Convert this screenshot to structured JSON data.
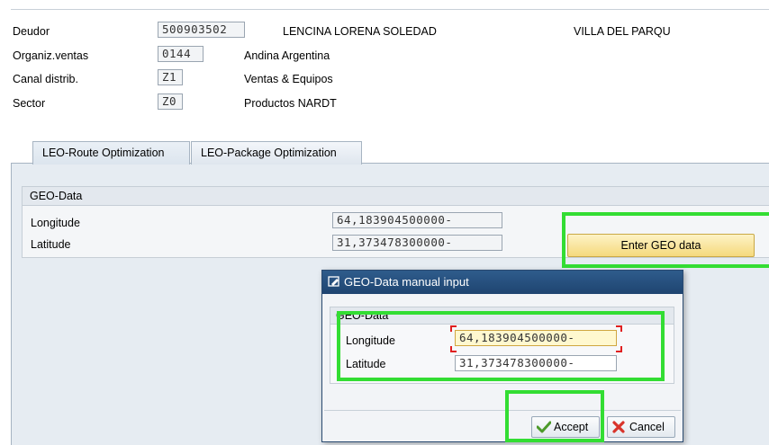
{
  "header": {
    "deudor_label": "Deudor",
    "deudor_value": "500903502",
    "deudor_name": "LENCINA LORENA SOLEDAD",
    "deudor_city": "VILLA DEL PARQU",
    "org_label": "Organiz.ventas",
    "org_value": "0144",
    "org_name": "Andina Argentina",
    "canal_label": "Canal distrib.",
    "canal_value": "Z1",
    "canal_name": "Ventas & Equipos",
    "sector_label": "Sector",
    "sector_value": "Z0",
    "sector_name": "Productos NARDT"
  },
  "tabs": [
    {
      "label": "LEO-Route Optimization",
      "active": true
    },
    {
      "label": "LEO-Package Optimization",
      "active": false
    }
  ],
  "geo": {
    "group_title": "GEO-Data",
    "longitude_label": "Longitude",
    "longitude_value": "64,183904500000-",
    "latitude_label": "Latitude",
    "latitude_value": "31,373478300000-",
    "enter_button": "Enter GEO data"
  },
  "dialog": {
    "title": "GEO-Data manual input",
    "group_title": "GEO-Data",
    "longitude_label": "Longitude",
    "longitude_value": "64,183904500000-",
    "latitude_label": "Latitude",
    "latitude_value": "31,373478300000-",
    "accept": "Accept",
    "cancel": "Cancel"
  },
  "colors": {
    "highlight": "#33dd33",
    "dialog_title": "#1e4470",
    "button_yellow": "#f5d97c"
  }
}
